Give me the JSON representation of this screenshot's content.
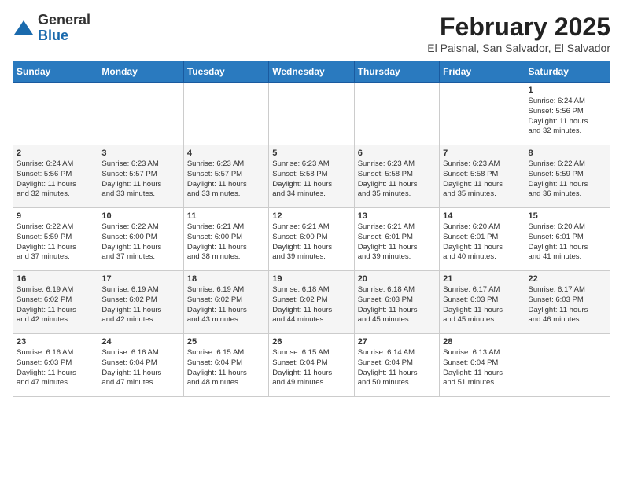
{
  "header": {
    "logo": {
      "line1": "General",
      "line2": "Blue",
      "icon": "▶"
    },
    "title": "February 2025",
    "location": "El Paisnal, San Salvador, El Salvador"
  },
  "calendar": {
    "days_of_week": [
      "Sunday",
      "Monday",
      "Tuesday",
      "Wednesday",
      "Thursday",
      "Friday",
      "Saturday"
    ],
    "weeks": [
      [
        {
          "day": "",
          "info": ""
        },
        {
          "day": "",
          "info": ""
        },
        {
          "day": "",
          "info": ""
        },
        {
          "day": "",
          "info": ""
        },
        {
          "day": "",
          "info": ""
        },
        {
          "day": "",
          "info": ""
        },
        {
          "day": "1",
          "info": "Sunrise: 6:24 AM\nSunset: 5:56 PM\nDaylight: 11 hours\nand 32 minutes."
        }
      ],
      [
        {
          "day": "2",
          "info": "Sunrise: 6:24 AM\nSunset: 5:56 PM\nDaylight: 11 hours\nand 32 minutes."
        },
        {
          "day": "3",
          "info": "Sunrise: 6:23 AM\nSunset: 5:57 PM\nDaylight: 11 hours\nand 33 minutes."
        },
        {
          "day": "4",
          "info": "Sunrise: 6:23 AM\nSunset: 5:57 PM\nDaylight: 11 hours\nand 33 minutes."
        },
        {
          "day": "5",
          "info": "Sunrise: 6:23 AM\nSunset: 5:58 PM\nDaylight: 11 hours\nand 34 minutes."
        },
        {
          "day": "6",
          "info": "Sunrise: 6:23 AM\nSunset: 5:58 PM\nDaylight: 11 hours\nand 35 minutes."
        },
        {
          "day": "7",
          "info": "Sunrise: 6:23 AM\nSunset: 5:58 PM\nDaylight: 11 hours\nand 35 minutes."
        },
        {
          "day": "8",
          "info": "Sunrise: 6:22 AM\nSunset: 5:59 PM\nDaylight: 11 hours\nand 36 minutes."
        }
      ],
      [
        {
          "day": "9",
          "info": "Sunrise: 6:22 AM\nSunset: 5:59 PM\nDaylight: 11 hours\nand 37 minutes."
        },
        {
          "day": "10",
          "info": "Sunrise: 6:22 AM\nSunset: 6:00 PM\nDaylight: 11 hours\nand 37 minutes."
        },
        {
          "day": "11",
          "info": "Sunrise: 6:21 AM\nSunset: 6:00 PM\nDaylight: 11 hours\nand 38 minutes."
        },
        {
          "day": "12",
          "info": "Sunrise: 6:21 AM\nSunset: 6:00 PM\nDaylight: 11 hours\nand 39 minutes."
        },
        {
          "day": "13",
          "info": "Sunrise: 6:21 AM\nSunset: 6:01 PM\nDaylight: 11 hours\nand 39 minutes."
        },
        {
          "day": "14",
          "info": "Sunrise: 6:20 AM\nSunset: 6:01 PM\nDaylight: 11 hours\nand 40 minutes."
        },
        {
          "day": "15",
          "info": "Sunrise: 6:20 AM\nSunset: 6:01 PM\nDaylight: 11 hours\nand 41 minutes."
        }
      ],
      [
        {
          "day": "16",
          "info": "Sunrise: 6:19 AM\nSunset: 6:02 PM\nDaylight: 11 hours\nand 42 minutes."
        },
        {
          "day": "17",
          "info": "Sunrise: 6:19 AM\nSunset: 6:02 PM\nDaylight: 11 hours\nand 42 minutes."
        },
        {
          "day": "18",
          "info": "Sunrise: 6:19 AM\nSunset: 6:02 PM\nDaylight: 11 hours\nand 43 minutes."
        },
        {
          "day": "19",
          "info": "Sunrise: 6:18 AM\nSunset: 6:02 PM\nDaylight: 11 hours\nand 44 minutes."
        },
        {
          "day": "20",
          "info": "Sunrise: 6:18 AM\nSunset: 6:03 PM\nDaylight: 11 hours\nand 45 minutes."
        },
        {
          "day": "21",
          "info": "Sunrise: 6:17 AM\nSunset: 6:03 PM\nDaylight: 11 hours\nand 45 minutes."
        },
        {
          "day": "22",
          "info": "Sunrise: 6:17 AM\nSunset: 6:03 PM\nDaylight: 11 hours\nand 46 minutes."
        }
      ],
      [
        {
          "day": "23",
          "info": "Sunrise: 6:16 AM\nSunset: 6:03 PM\nDaylight: 11 hours\nand 47 minutes."
        },
        {
          "day": "24",
          "info": "Sunrise: 6:16 AM\nSunset: 6:04 PM\nDaylight: 11 hours\nand 47 minutes."
        },
        {
          "day": "25",
          "info": "Sunrise: 6:15 AM\nSunset: 6:04 PM\nDaylight: 11 hours\nand 48 minutes."
        },
        {
          "day": "26",
          "info": "Sunrise: 6:15 AM\nSunset: 6:04 PM\nDaylight: 11 hours\nand 49 minutes."
        },
        {
          "day": "27",
          "info": "Sunrise: 6:14 AM\nSunset: 6:04 PM\nDaylight: 11 hours\nand 50 minutes."
        },
        {
          "day": "28",
          "info": "Sunrise: 6:13 AM\nSunset: 6:04 PM\nDaylight: 11 hours\nand 51 minutes."
        },
        {
          "day": "",
          "info": ""
        }
      ]
    ]
  }
}
